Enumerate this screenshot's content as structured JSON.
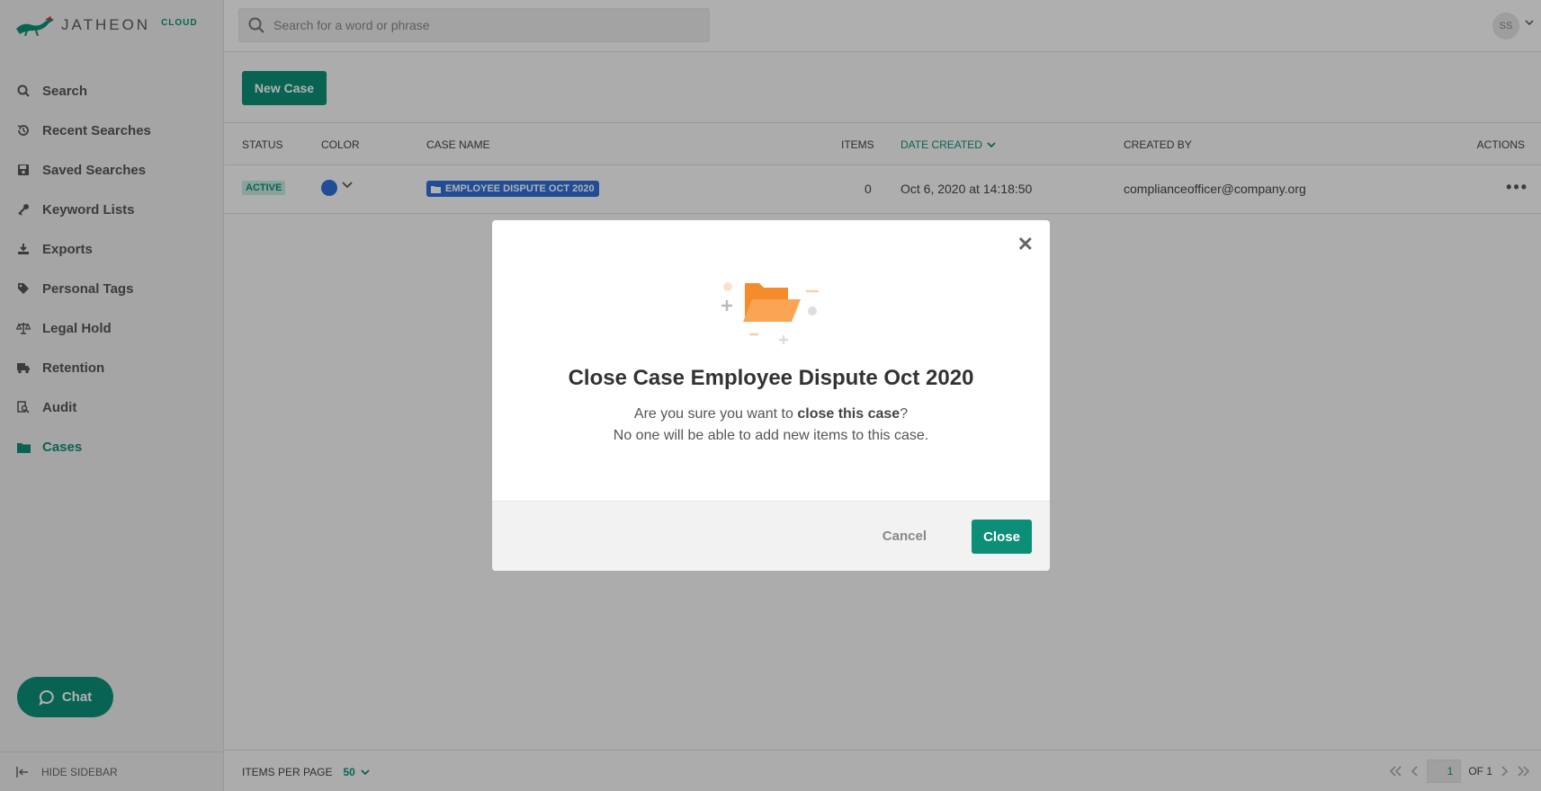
{
  "brand": {
    "name": "JATHEON",
    "suffix": "CLOUD",
    "accent": "#0d8f77"
  },
  "sidebar": {
    "items": [
      {
        "label": "Search",
        "icon": "search-icon"
      },
      {
        "label": "Recent Searches",
        "icon": "history-icon"
      },
      {
        "label": "Saved Searches",
        "icon": "floppy-disk-icon"
      },
      {
        "label": "Keyword Lists",
        "icon": "key-icon"
      },
      {
        "label": "Exports",
        "icon": "download-icon"
      },
      {
        "label": "Personal Tags",
        "icon": "tag-icon"
      },
      {
        "label": "Legal Hold",
        "icon": "scale-icon"
      },
      {
        "label": "Retention",
        "icon": "truck-icon"
      },
      {
        "label": "Audit",
        "icon": "audit-search-icon"
      },
      {
        "label": "Cases",
        "icon": "folder-icon",
        "active": true
      }
    ],
    "chat_label": "Chat",
    "hide_label": "HIDE SIDEBAR"
  },
  "topbar": {
    "search_placeholder": "Search for a word or phrase",
    "avatar_initials": "SS"
  },
  "main": {
    "new_case_label": "New Case",
    "columns": {
      "status": "STATUS",
      "color": "COLOR",
      "case_name": "CASE NAME",
      "items": "ITEMS",
      "date_created": "DATE CREATED",
      "created_by": "CREATED BY",
      "actions": "ACTIONS"
    },
    "rows": [
      {
        "status": "ACTIVE",
        "color": "#2f6fd6",
        "case_name": "EMPLOYEE DISPUTE OCT 2020",
        "items": "0",
        "date_created": "Oct 6, 2020 at 14:18:50",
        "created_by": "complianceofficer@company.org"
      }
    ],
    "footer": {
      "items_per_page_label": "ITEMS PER PAGE",
      "items_per_page_value": "50",
      "page": "1",
      "of_label": "OF 1"
    }
  },
  "modal": {
    "title": "Close Case Employee Dispute Oct 2020",
    "msg_prefix": "Are you sure you want to ",
    "msg_bold": "close this case",
    "msg_suffix": "?",
    "msg_line2": "No one will be able to add new items to this case.",
    "cancel_label": "Cancel",
    "confirm_label": "Close"
  }
}
